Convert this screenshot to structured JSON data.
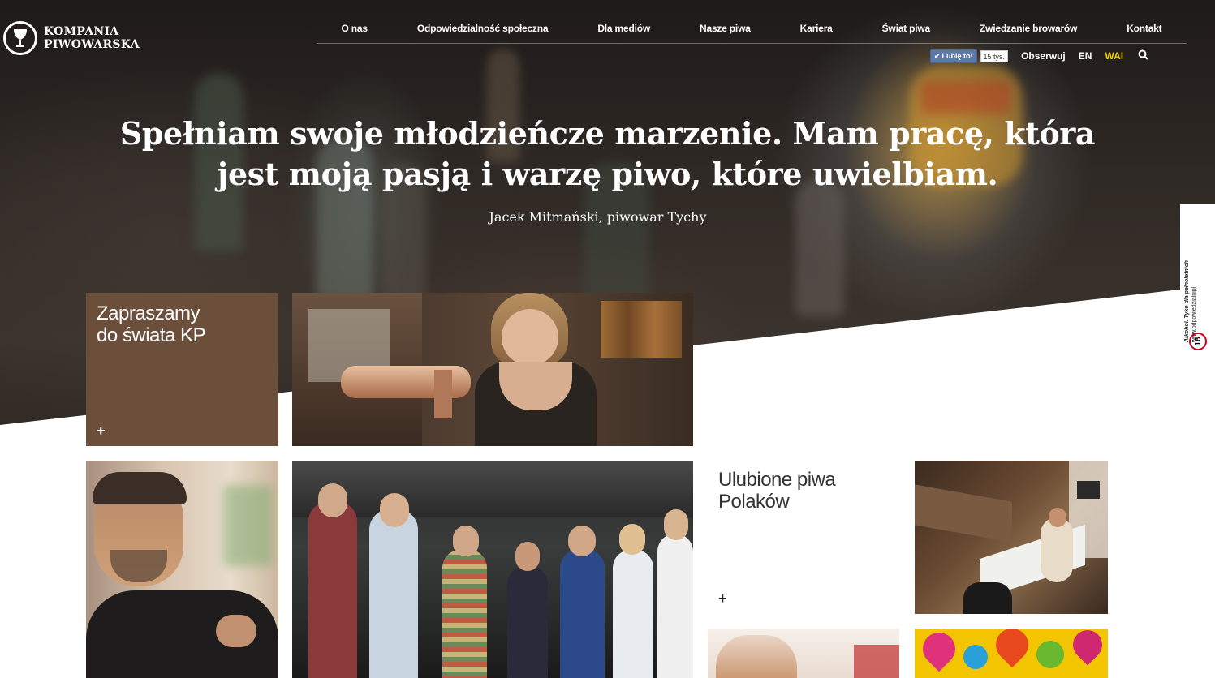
{
  "brand": {
    "logo_line1": "KOMPANIA",
    "logo_line2": "PIWOWARSKA"
  },
  "nav": {
    "items": [
      "O nas",
      "Odpowiedzialność społeczna",
      "Dla mediów",
      "Nasze piwa",
      "Kariera",
      "Świat piwa",
      "Zwiedzanie browarów",
      "Kontakt"
    ]
  },
  "subnav": {
    "fb_like": "Lubię to!",
    "fb_count": "15 tys.",
    "follow": "Obserwuj",
    "lang": "EN",
    "wai": "WAI"
  },
  "hero": {
    "quote": "Spełniam swoje młodzieńcze marzenie. Mam pracę, która jest moją pasją i warzę piwo, które uwielbiam.",
    "author": "Jacek Mitmański, piwowar Tychy"
  },
  "age_badge": {
    "text1": "Alkohol. Tyko dla pełnoletnich",
    "text2": "www.odpowiedzialnipl",
    "age": "18"
  },
  "tiles": {
    "invite_title": "Zapraszamy do świata KP",
    "invite_plus": "+",
    "favorite_title": "Ulubione piwa Polaków",
    "favorite_plus": "+"
  },
  "colors": {
    "brown_tile": "#6b4f3a",
    "wai": "#f2d100",
    "fb": "#5f78ab"
  }
}
